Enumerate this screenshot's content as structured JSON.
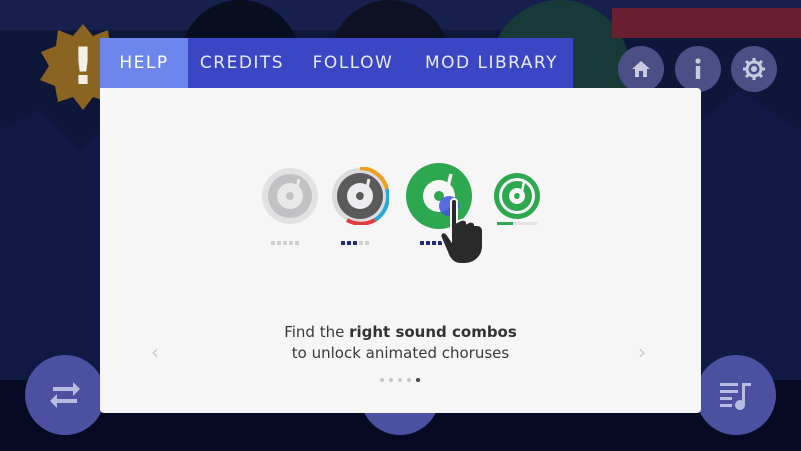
{
  "tabs": [
    {
      "label": "HELP",
      "active": true
    },
    {
      "label": "CREDITS",
      "active": false
    },
    {
      "label": "FOLLOW",
      "active": false
    },
    {
      "label": "MOD LIBRARY",
      "active": false
    }
  ],
  "top_buttons": {
    "home_icon": "home-icon",
    "info_icon": "info-icon",
    "settings_icon": "gear-icon"
  },
  "alert_badge": {
    "icon": "exclamation-icon",
    "symbol": "!"
  },
  "help_slide": {
    "caption_line1_prefix": "Find the ",
    "caption_line1_bold": "right sound combos",
    "caption_line2": "to unlock animated choruses",
    "prev_arrow": "‹",
    "next_arrow": "›",
    "page_count": 5,
    "current_page": 5
  },
  "discs": [
    {
      "state": "locked",
      "progress_dots": 5,
      "filled_dots": 0
    },
    {
      "state": "partial",
      "progress_dots": 5,
      "filled_dots": 3
    },
    {
      "state": "active",
      "progress_dots": 5,
      "filled_dots": 5
    },
    {
      "state": "unlocked",
      "progress_level": 0.4
    }
  ],
  "colors": {
    "tab_bar": "#3b46c4",
    "tab_active": "#6d86ee",
    "disc_green": "#2ea84f",
    "disc_grey": "#5a5a5a",
    "ring_orange": "#f0a020",
    "ring_blue": "#2aa9d8",
    "ring_red": "#e23b3b",
    "dot_navy": "#232c7c",
    "badge_gold": "#8a6420"
  }
}
